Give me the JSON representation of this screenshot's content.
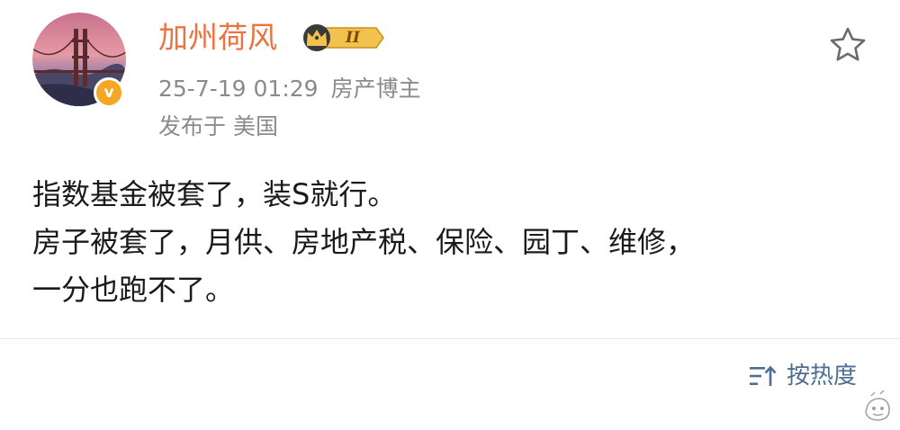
{
  "post": {
    "author": {
      "name": "加州荷风",
      "verified_mark": "v",
      "level_label": "II"
    },
    "time": "25-7-19 01:29",
    "source_tag": "房产博主",
    "location": "发布于 美国",
    "content_lines": [
      "指数基金被套了，装S就行。",
      "房子被套了，月供、房地产税、保险、园丁、维修，",
      "一分也跑不了。"
    ]
  },
  "footer": {
    "sort_label": "按热度"
  },
  "icons": {
    "favorite": "star-outline-icon",
    "sort": "sort-lines-icon",
    "level": "crown-icon"
  },
  "colors": {
    "username": "#eb7340",
    "meta": "#8a8a8a",
    "content": "#1a1a1a",
    "sort_link": "#4f6e94",
    "verified": "#f5a623",
    "level_gold": "#f2c14e"
  }
}
